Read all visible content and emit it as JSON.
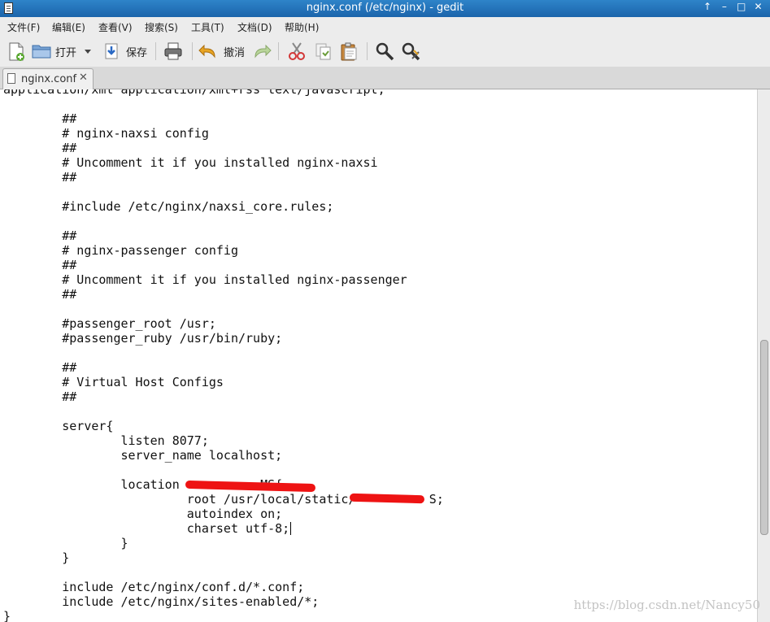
{
  "window": {
    "title": "nginx.conf (/etc/nginx) - gedit",
    "controls": [
      "↑",
      "–",
      "□",
      "✕"
    ]
  },
  "menu": [
    "文件(F)",
    "编辑(E)",
    "查看(V)",
    "搜索(S)",
    "工具(T)",
    "文档(D)",
    "帮助(H)"
  ],
  "toolbar": {
    "open_label": "打开",
    "save_label": "保存",
    "undo_label": "撤消"
  },
  "tab": {
    "title": "nginx.conf",
    "close": "✕"
  },
  "editor": {
    "lines": [
      "application/xml application/xml+rss text/javascript;",
      "",
      "        ##",
      "        # nginx-naxsi config",
      "        ##",
      "        # Uncomment it if you installed nginx-naxsi",
      "        ##",
      "",
      "        #include /etc/nginx/naxsi_core.rules;",
      "",
      "        ##",
      "        # nginx-passenger config",
      "        ##",
      "        # Uncomment it if you installed nginx-passenger",
      "        ##",
      "",
      "        #passenger_root /usr;",
      "        #passenger_ruby /usr/bin/ruby;",
      "",
      "        ##",
      "        # Virtual Host Configs",
      "        ##",
      "",
      "        server{",
      "                listen 8077;",
      "                server_name localhost;",
      "",
      "                location           MS{",
      "                         root /usr/local/static/          S;",
      "                         autoindex on;",
      "                         charset utf-8;",
      "                }",
      "        }",
      "",
      "        include /etc/nginx/conf.d/*.conf;",
      "        include /etc/nginx/sites-enabled/*;",
      "}"
    ]
  },
  "watermark": "https://blog.csdn.net/Nancy50"
}
